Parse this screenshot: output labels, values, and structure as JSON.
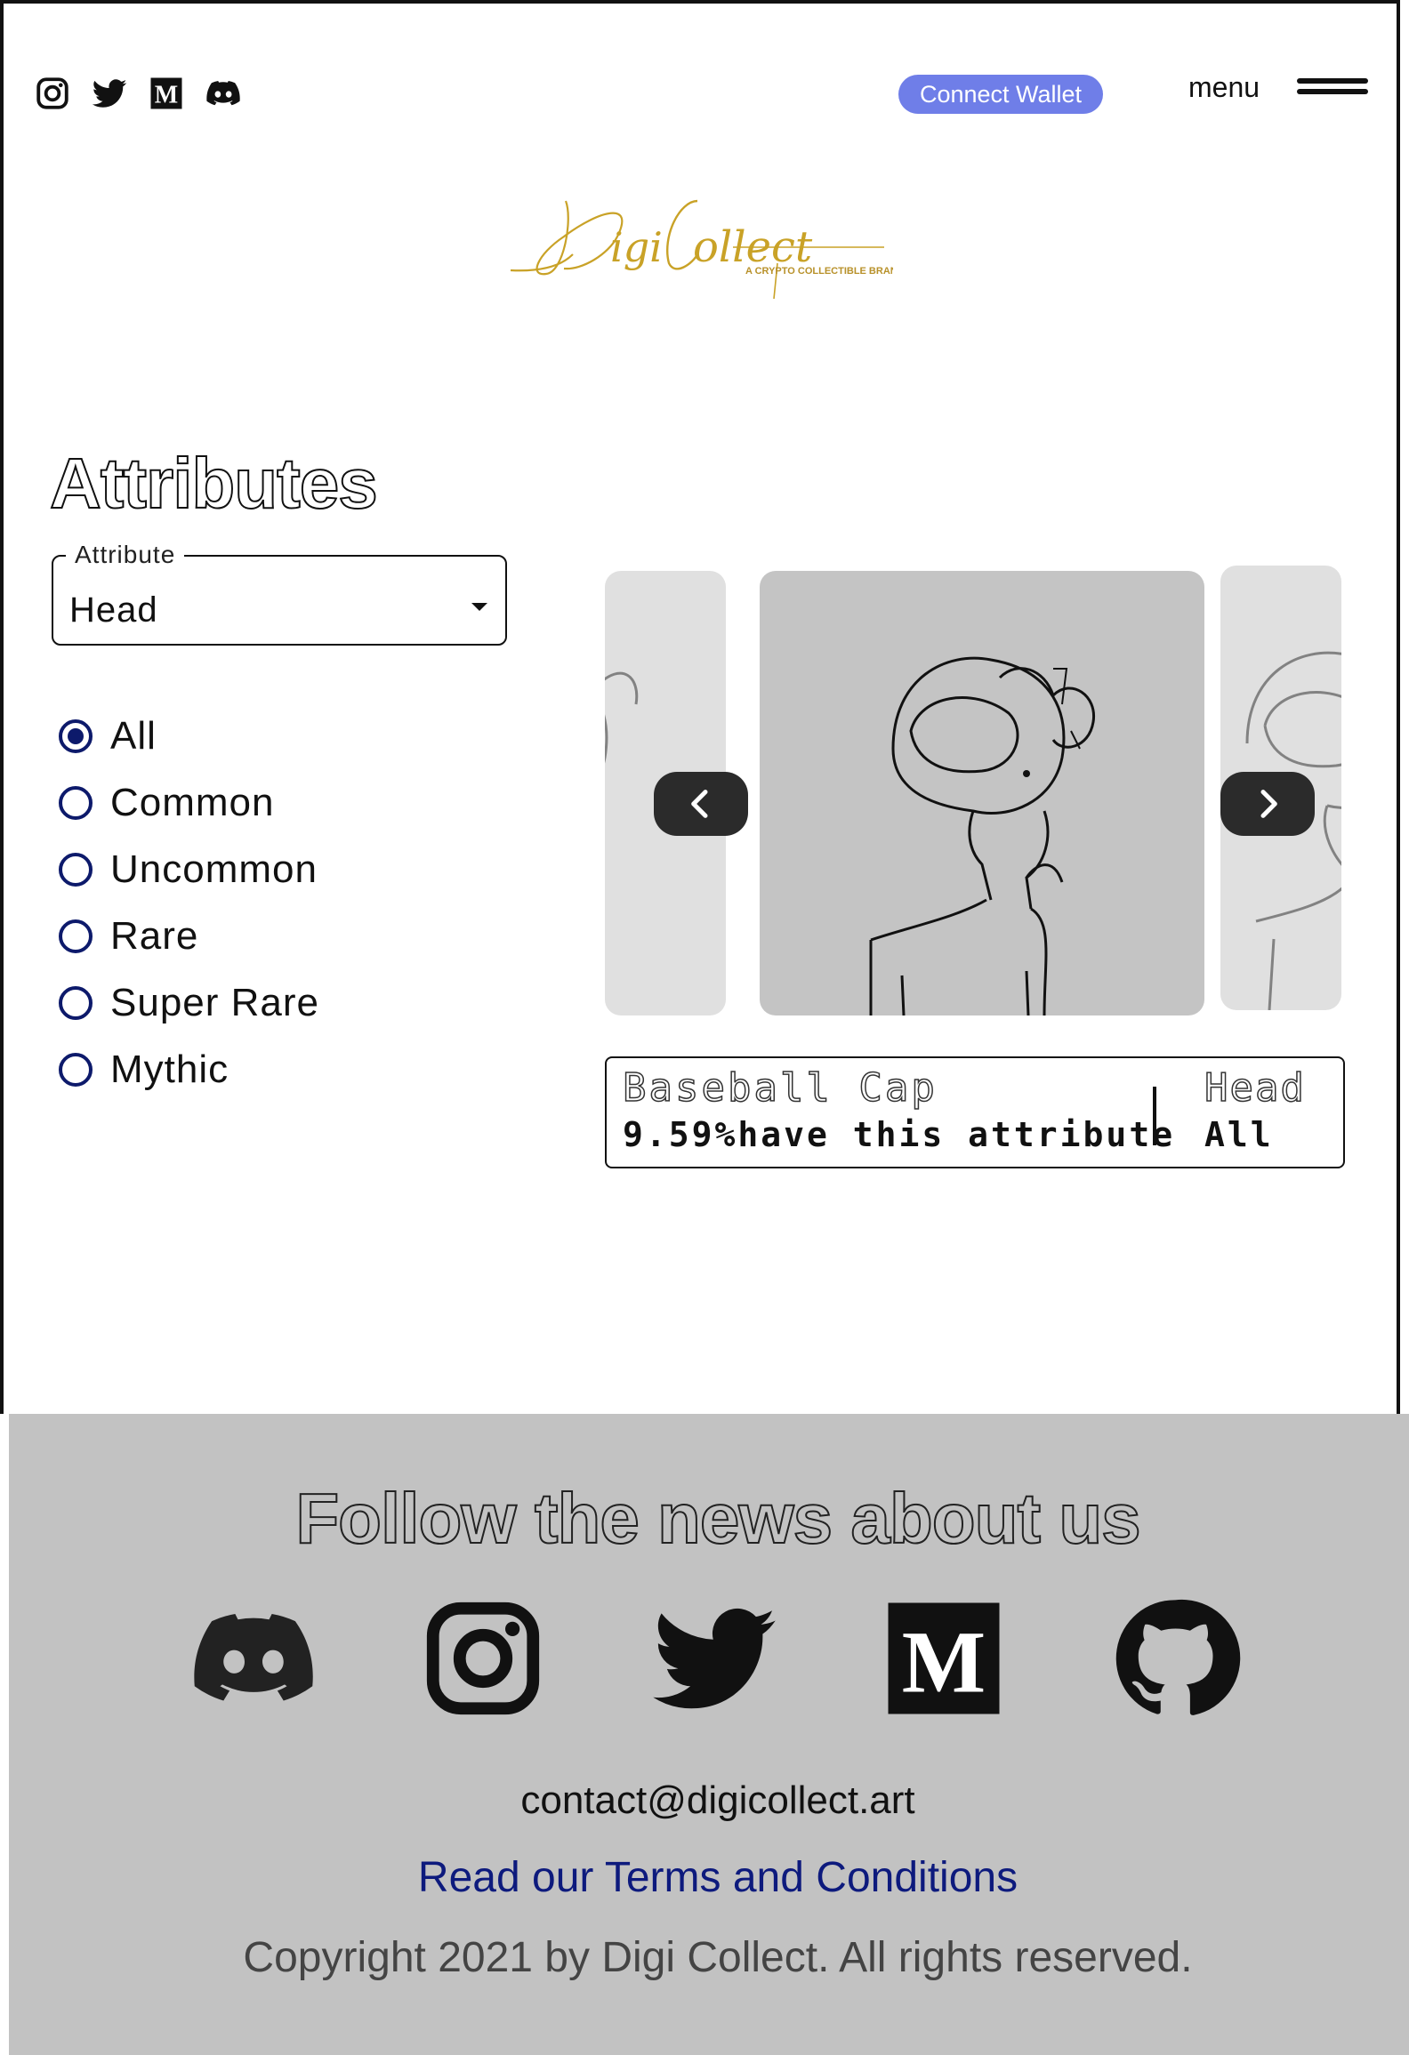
{
  "header": {
    "social_icons": [
      "instagram-icon",
      "twitter-icon",
      "medium-icon",
      "discord-icon"
    ],
    "connect_label": "Connect Wallet",
    "menu_label": "menu"
  },
  "logo": {
    "wordmark": "DigiCollect",
    "tagline": "A CRYPTO COLLECTIBLE BRAND"
  },
  "attributes": {
    "title": "Attributes",
    "select_legend": "Attribute",
    "selected_attribute": "Head",
    "rarity_options": [
      "All",
      "Common",
      "Uncommon",
      "Rare",
      "Super Rare",
      "Mythic"
    ],
    "selected_rarity": "All"
  },
  "carousel": {
    "item_name": "Baseball Cap",
    "percentage_text": "9.59%have this attribute",
    "category": "Head",
    "rarity": "All"
  },
  "footer": {
    "follow_title": "Follow the news about us",
    "icons": [
      "discord-icon",
      "instagram-icon",
      "twitter-icon",
      "medium-icon",
      "github-icon"
    ],
    "contact_email": "contact@digicollect.art",
    "terms_label": "Read our Terms and Conditions",
    "copyright": "Copyright 2021 by Digi Collect. All rights reserved."
  },
  "colors": {
    "connect_button": "#6f7ee8",
    "radio_accent": "#0d1a6b",
    "terms_link": "#0d1a7d",
    "footer_bg": "#c2c2c2",
    "logo_gold": "#c9a227"
  }
}
